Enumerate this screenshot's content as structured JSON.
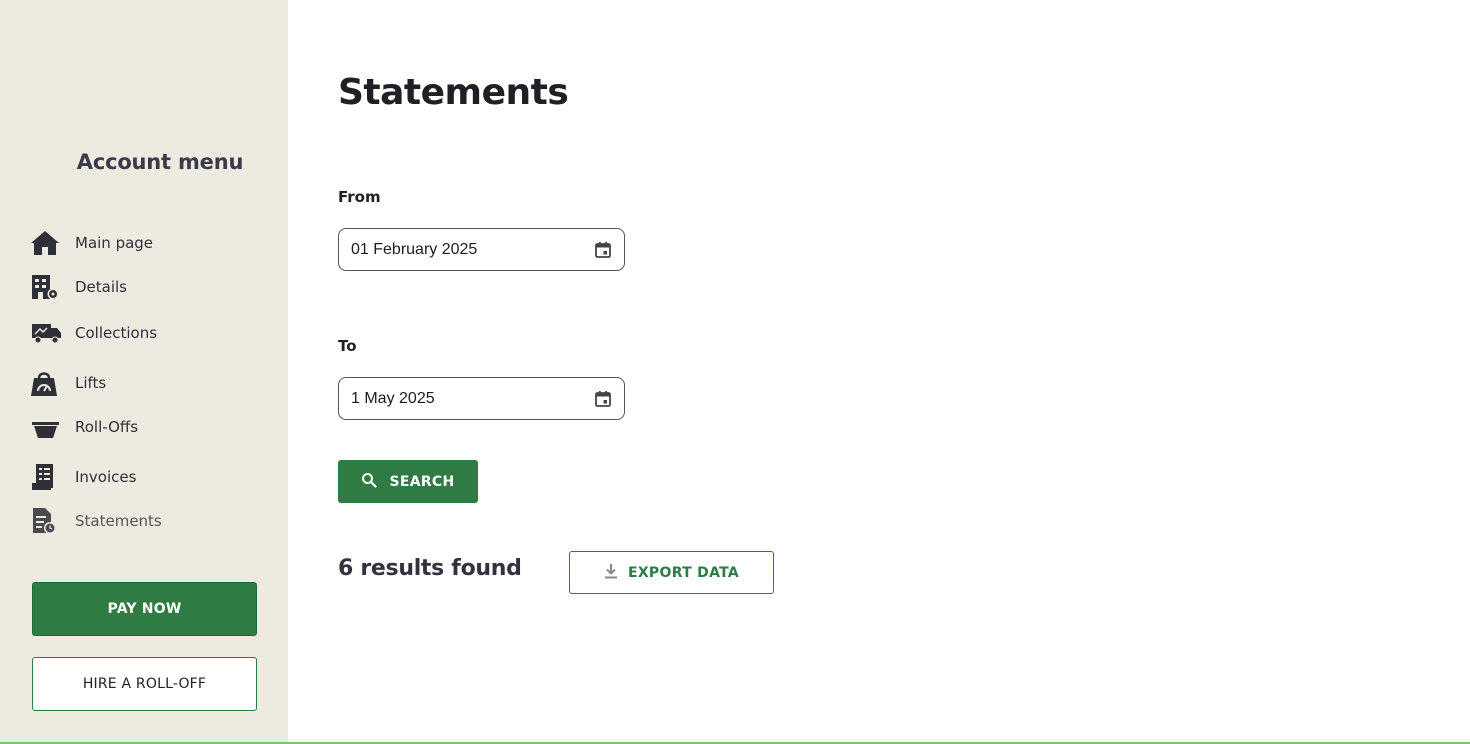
{
  "sidebar": {
    "title": "Account menu",
    "items": [
      {
        "label": "Main page",
        "icon": "home-icon"
      },
      {
        "label": "Details",
        "icon": "building-gear-icon"
      },
      {
        "label": "Collections",
        "icon": "truck-icon"
      },
      {
        "label": "Lifts",
        "icon": "bag-gauge-icon"
      },
      {
        "label": "Roll-Offs",
        "icon": "bin-icon"
      },
      {
        "label": "Invoices",
        "icon": "receipt-icon"
      },
      {
        "label": "Statements",
        "icon": "document-clock-icon"
      }
    ],
    "active_item": "Statements",
    "pay_now_label": "PAY NOW",
    "hire_label": "HIRE A ROLL-OFF"
  },
  "main": {
    "title": "Statements",
    "from_label": "From",
    "from_value": "01 February 2025",
    "to_label": "To",
    "to_value": "1 May 2025",
    "search_label": "SEARCH",
    "results_text": "6 results found",
    "export_label": "EXPORT DATA"
  },
  "colors": {
    "accent": "#2e7b43",
    "sidebar_bg": "#edebe0",
    "bottom_line": "#7cc36a"
  }
}
